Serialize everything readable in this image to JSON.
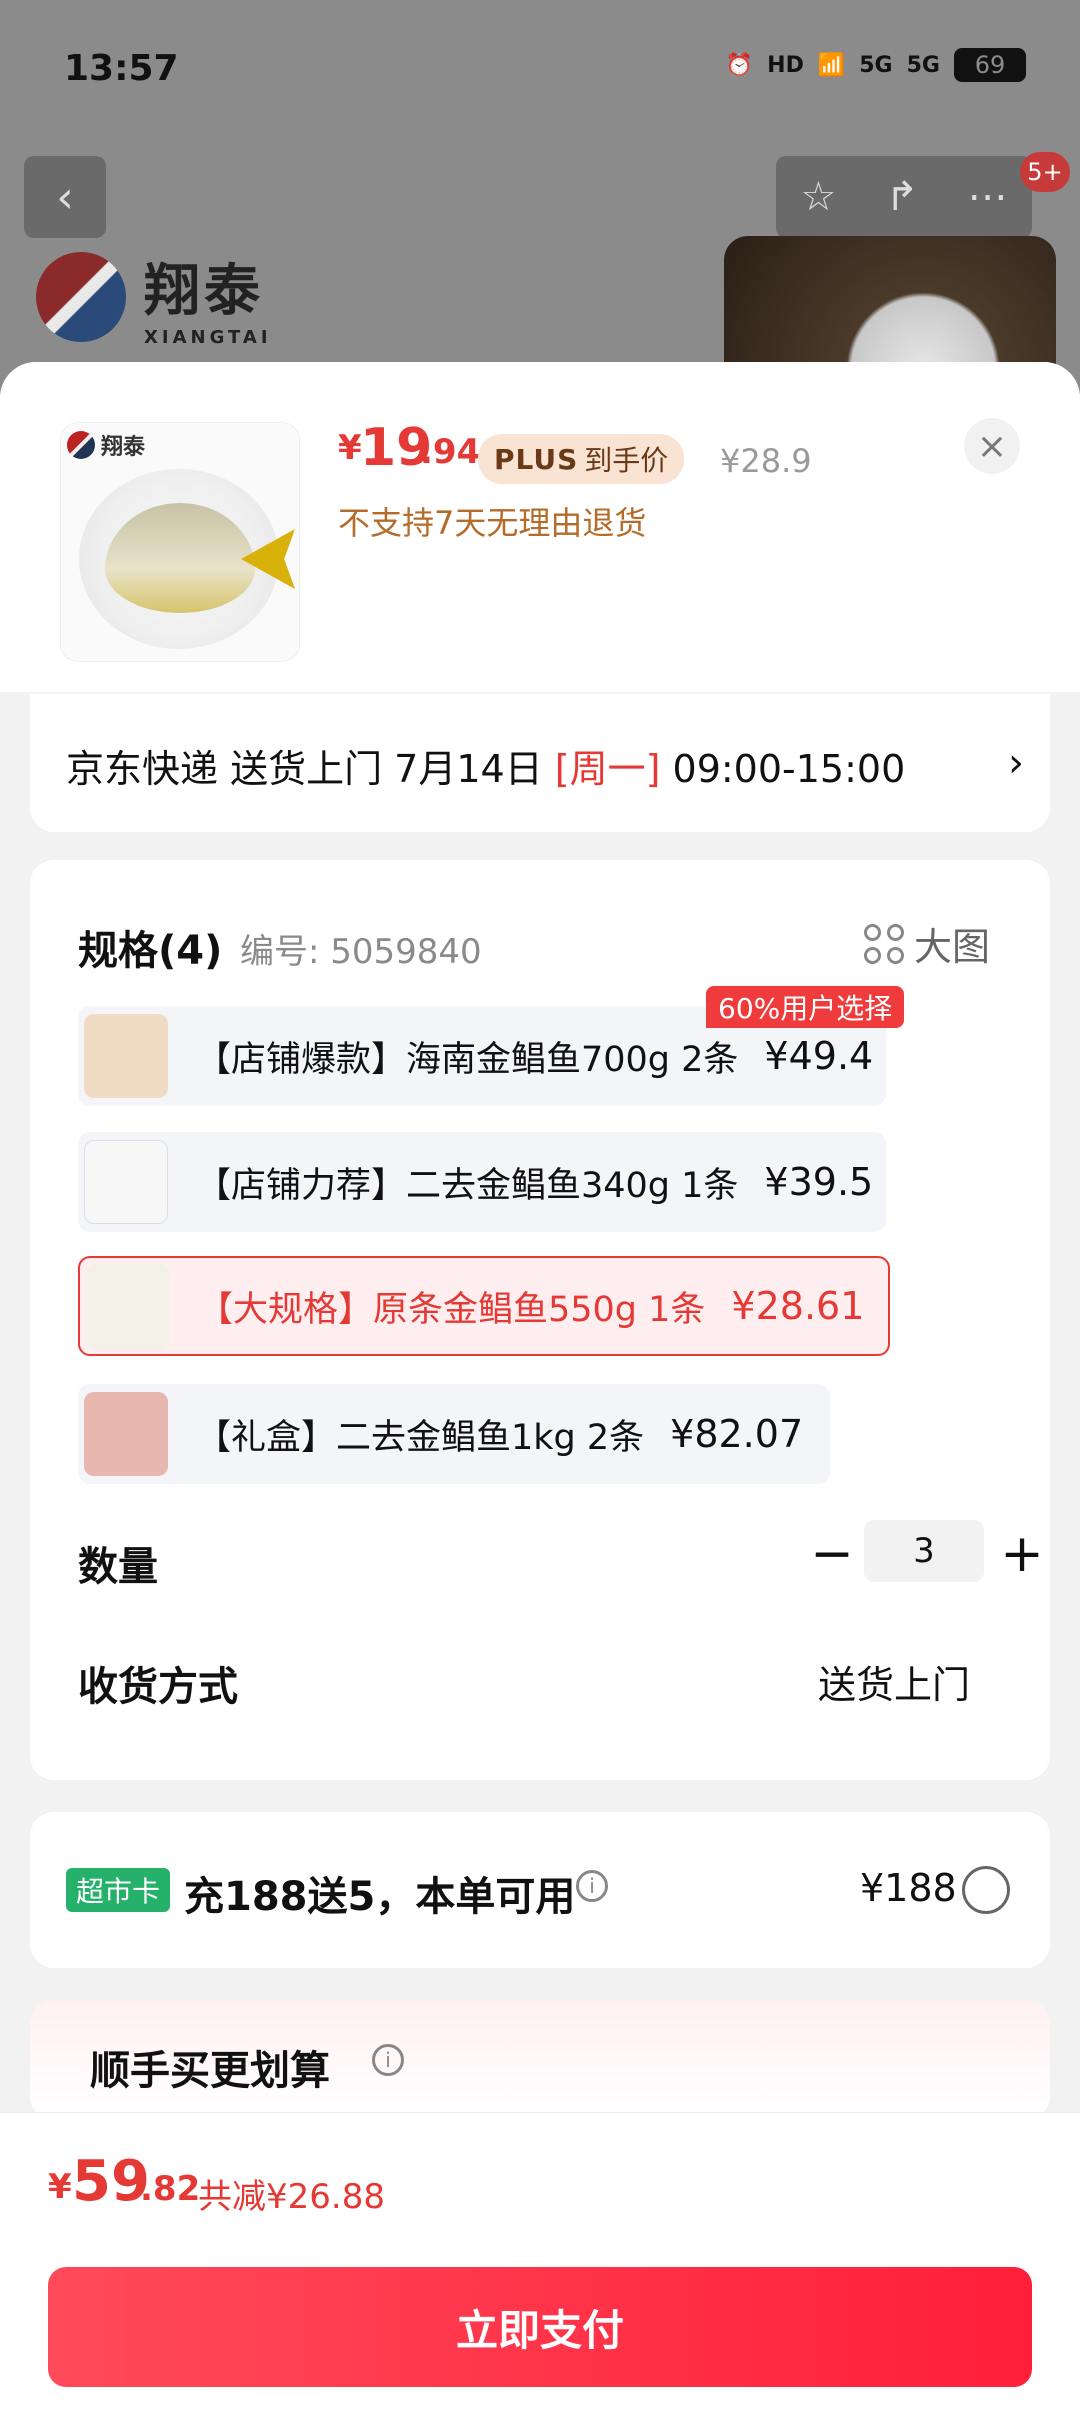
{
  "status_bar": {
    "time": "13:57",
    "hd_label": "HD",
    "network_1": "5G",
    "network_2": "5G",
    "battery": "69"
  },
  "background": {
    "brand_cn": "翔泰",
    "brand_en": "XIANGTAI",
    "notification_badge": "5+"
  },
  "product": {
    "thumb_brand": "翔泰",
    "price_currency": "¥",
    "price_int": "19",
    "price_dec": ".94",
    "plus_label": "PLUS",
    "plus_suffix": "到手价",
    "old_price": "¥28.9",
    "return_policy": "不支持7天无理由退货"
  },
  "delivery": {
    "text_before": "京东快递 送货上门 7月14日 ",
    "day": "[周一]",
    "text_after": " 09:00-15:00",
    "chevron": "›"
  },
  "spec": {
    "title": "规格(4)",
    "code": "编号: 5059840",
    "big_image_label": "大图",
    "popular_tag": "60%用户选择",
    "options": [
      {
        "label": "【店铺爆款】海南金鲳鱼700g 2条",
        "price": "¥49.4"
      },
      {
        "label": "【店铺力荐】二去金鲳鱼340g 1条",
        "price": "¥39.5"
      },
      {
        "label": "【大规格】原条金鲳鱼550g 1条",
        "price": "¥28.61"
      },
      {
        "label": "【礼盒】二去金鲳鱼1kg 2条",
        "price": "¥82.07"
      }
    ],
    "quantity_label": "数量",
    "quantity_value": "3",
    "minus_symbol": "−",
    "plus_symbol": "+",
    "shipping_label": "收货方式",
    "shipping_value": "送货上门"
  },
  "card_offer": {
    "tag": "超市卡",
    "text": "充188送5，本单可用",
    "info_symbol": "i",
    "price": "¥188"
  },
  "more": {
    "title": "顺手买更划算",
    "info_symbol": "i"
  },
  "footer": {
    "total_currency": "¥",
    "total_int": "59",
    "total_dec": ".82",
    "savings": "共减¥26.88",
    "pay_label": "立即支付"
  },
  "colors": {
    "accent_red": "#e53935",
    "market_green": "#25b16a",
    "plus_bg": "#f9e3d3"
  }
}
